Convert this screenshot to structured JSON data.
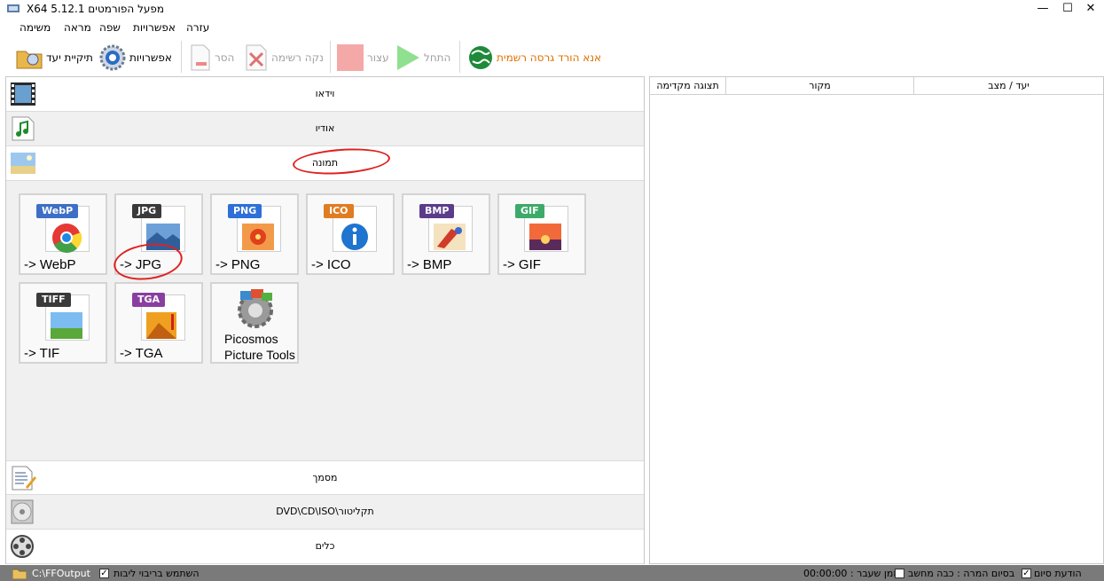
{
  "window": {
    "title": "X64 5.12.1 מפעל הפורמטים",
    "minimize": "—",
    "maximize": "☐",
    "close": "✕"
  },
  "menu": {
    "items": [
      "משימה",
      "מראה",
      "שפה",
      "אפשרויות",
      "עזרה"
    ]
  },
  "toolbar": {
    "output_folder": "תיקיית יעד",
    "options": "אפשרויות",
    "remove": "הסר",
    "clear_list": "נקה רשימה",
    "stop": "עצור",
    "start": "התחל",
    "download": "אנא הורד גרסה רשמית"
  },
  "categories": {
    "video": "וידאו",
    "audio": "אודיו",
    "image": "תמונה",
    "document": "מסמך",
    "rom": "תקליטור\\DVD\\CD\\ISO",
    "tools": "כלים"
  },
  "image_formats": [
    {
      "badge": "WebP",
      "label": "-> WebP",
      "color": "#3d6fc6"
    },
    {
      "badge": "JPG",
      "label": "-> JPG",
      "color": "#3a3a3a"
    },
    {
      "badge": "PNG",
      "label": "-> PNG",
      "color": "#2e6fd8"
    },
    {
      "badge": "ICO",
      "label": "-> ICO",
      "color": "#e07c22"
    },
    {
      "badge": "BMP",
      "label": "-> BMP",
      "color": "#5a3c8a"
    },
    {
      "badge": "GIF",
      "label": "-> GIF",
      "color": "#3daa6a"
    },
    {
      "badge": "TIFF",
      "label": "-> TIF",
      "color": "#3a3a3a"
    },
    {
      "badge": "TGA",
      "label": "-> TGA",
      "color": "#8a3fa0"
    }
  ],
  "picosmos": {
    "line1": "Picosmos",
    "line2": "Picture Tools"
  },
  "task_table": {
    "columns": [
      "תצוגה מקדימה",
      "מקור",
      "יעד / מצב"
    ]
  },
  "status": {
    "output_path": "C:\\FFOutput",
    "multithread": "השתמש בריבוי ליבות",
    "elapsed": "זמן שעבר : 00:00:00",
    "shutdown": "בסיום המרה : כבה מחשב",
    "notify": "הודעת סיום"
  }
}
